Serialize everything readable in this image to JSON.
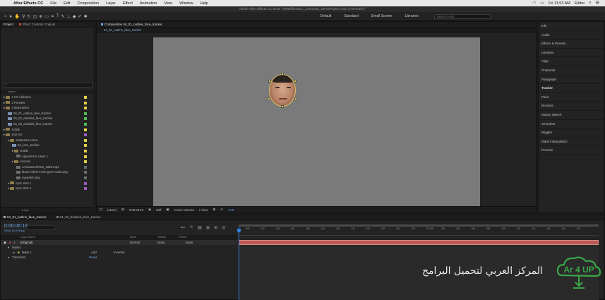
{
  "menubar": {
    "app": "After Effects CC",
    "items": [
      "File",
      "Edit",
      "Composition",
      "Layer",
      "Effect",
      "Animation",
      "View",
      "Window",
      "Help"
    ],
    "time": "Fri 11:53 AM",
    "user": "Editor"
  },
  "titlebar": {
    "title": "Adobe After Effects CC 2018 - AfterEffectsCC_June2018_DemoProject copy (converted) *"
  },
  "workspaces": [
    "Default",
    "Standard",
    "Small Screen",
    "Libraries"
  ],
  "search_help": "Search Help",
  "project": {
    "tabs": [
      "Project",
      "Effect Controls Original"
    ],
    "column_name": "Name",
    "items": [
      {
        "label": "1 CC Libraries",
        "indent": 0,
        "type": "folder",
        "color": "#e5d34a"
      },
      {
        "label": "2 Preview",
        "indent": 0,
        "type": "folder",
        "color": "#e5d34a"
      },
      {
        "label": "4 facetracker",
        "indent": 0,
        "type": "folder",
        "color": "#e5d34a"
      },
      {
        "label": "04_01_outline_face_tracker",
        "indent": 1,
        "type": "comp",
        "color": "#4fbf59"
      },
      {
        "label": "04_02_detailed_face_tracker",
        "indent": 1,
        "type": "comp",
        "color": "#4fbf59"
      },
      {
        "label": "04_03_detailed_face_tracker",
        "indent": 1,
        "type": "comp",
        "color": "#4fbf59"
      },
      {
        "label": "Solids",
        "indent": 0,
        "type": "folder",
        "color": "#e5d34a"
      },
      {
        "label": "sources",
        "indent": 0,
        "type": "folder",
        "color": "#a05cc4"
      },
      {
        "label": "assassins scene",
        "indent": 1,
        "type": "folder",
        "color": "#e5d34a"
      },
      {
        "label": "04_face_tracker",
        "indent": 2,
        "type": "comp",
        "color": "#e5d34a"
      },
      {
        "label": "Solids",
        "indent": 2,
        "type": "folder",
        "color": "#e5d34a"
      },
      {
        "label": "Adjustment Layer 1",
        "indent": 3,
        "type": "file",
        "color": "#e5d34a"
      },
      {
        "label": "sources",
        "indent": 2,
        "type": "folder",
        "color": "#e5d34a"
      },
      {
        "label": "1AssassinsFlats_1820.mp4",
        "indent": 3,
        "type": "file",
        "color": "#6d6d6d"
      },
      {
        "label": "black-velvet-mesh-gree-mask.png",
        "indent": 3,
        "type": "file",
        "color": "#6d6d6d"
      },
      {
        "label": "eyepatch.png",
        "indent": 3,
        "type": "file",
        "color": "#6d6d6d"
      },
      {
        "label": "sync shot 1",
        "indent": 1,
        "type": "folder",
        "color": "#a05cc4"
      },
      {
        "label": "sync shot 2",
        "indent": 1,
        "type": "folder",
        "color": "#a05cc4"
      }
    ],
    "footer": "8 bpc"
  },
  "composition": {
    "tab": "Composition 04_01_outline_face_tracker",
    "subtab": "04_01_outline_face_tracker",
    "zoom": "(116%)",
    "timecode": "0:00:06:19",
    "resolution": "Half",
    "camera": "Active Camera",
    "views": "1 View",
    "exposure": "+0.0"
  },
  "right_panel": {
    "items": [
      "Info",
      "Audio",
      "Effects & Presets",
      "Libraries",
      "Align",
      "Character",
      "Paragraph",
      "Tracker",
      "Paint",
      "Brushes",
      "Motion Sketch",
      "Smoother",
      "Wiggler",
      "Mask Interpolation",
      "Preview"
    ],
    "active": "Tracker"
  },
  "timeline": {
    "tabs": [
      "04_01_outline_face_tracker",
      "04_03_detailed_face_tracker"
    ],
    "timecode": "0:00:06:19",
    "timecode_sub": "00163 (23.976 fps)",
    "columns": {
      "layer_name": "Layer Name",
      "mode": "Mode",
      "trkmat": "TrkMat",
      "parent": "Parent"
    },
    "layer": {
      "index": "1",
      "name": "[Original]",
      "mode": "Normal",
      "trkmat": "None",
      "parent": "None"
    },
    "masks_label": "Masks",
    "mask": {
      "name": "Mask 1",
      "mode": "Add",
      "inverted": "Inverted"
    },
    "transform_label": "Transform",
    "transform_reset": "Reset",
    "ruler": [
      "00f",
      "02f",
      "04f",
      "06f",
      "08f",
      "10f",
      "12f",
      "14f",
      "16f",
      "18f",
      "20f",
      "22f",
      "01:00f",
      "02f",
      "04f",
      "06f",
      "08f",
      "10f",
      "12f",
      "14f",
      "16f",
      "18f",
      "20f"
    ]
  },
  "watermark": {
    "text": "المركز العربي لتحميل البرامج",
    "logo": "Ar 4 UP"
  },
  "colors": {
    "accent": "#2f7fe0",
    "layer_bar": "#b95a55",
    "viewer_bg": "#7a7a7a"
  }
}
